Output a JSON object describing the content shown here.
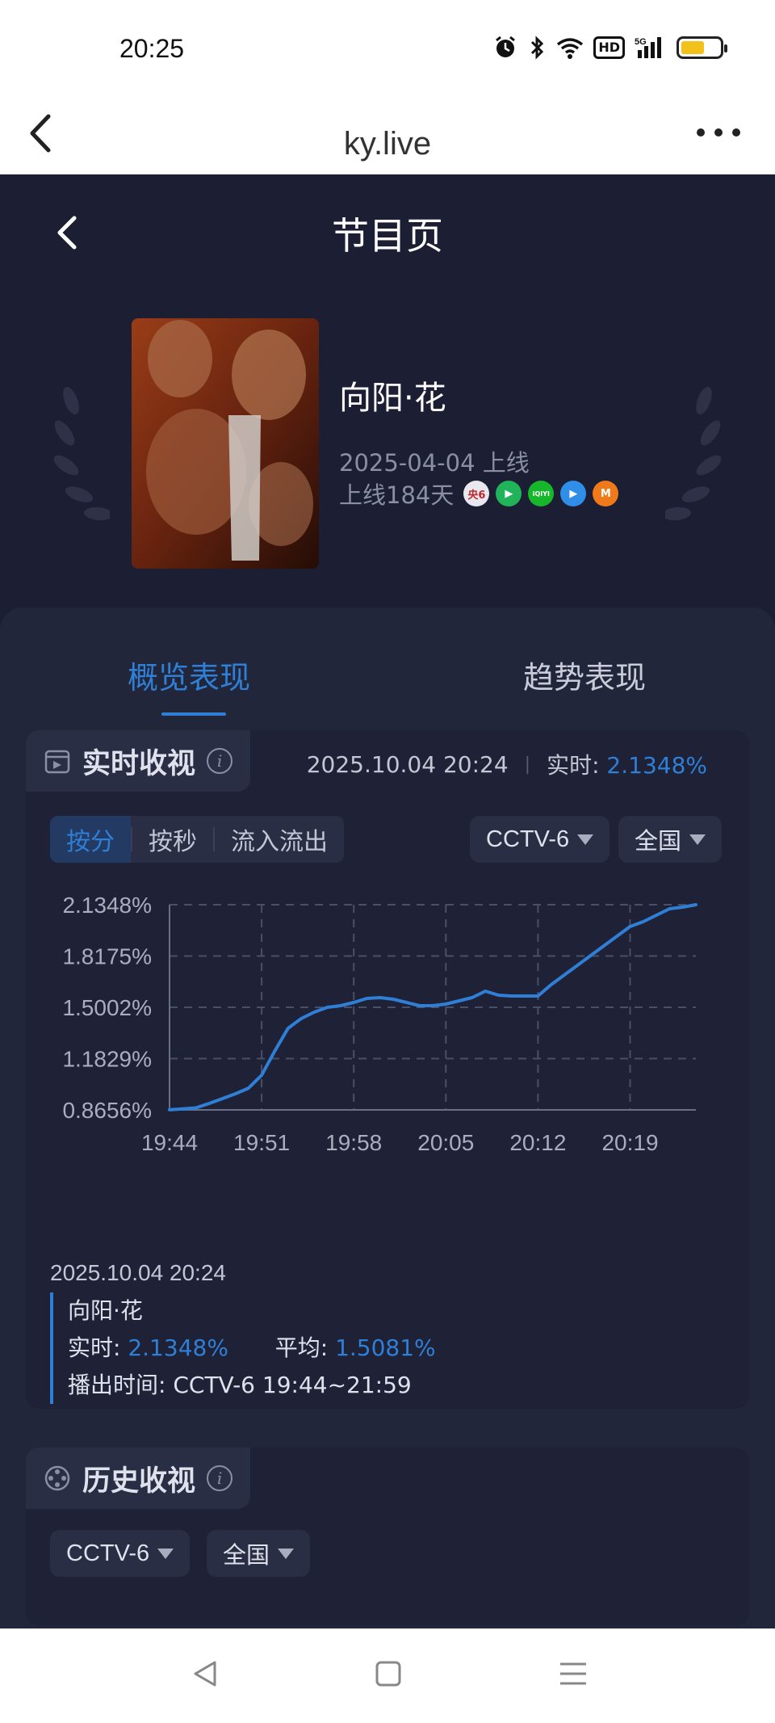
{
  "status": {
    "time": "20:25",
    "hd": "HD",
    "signal": "5G",
    "battery_level": 0.6
  },
  "browser": {
    "title": "ky.live"
  },
  "nav": {
    "title": "节目页"
  },
  "show": {
    "title": "向阳·花",
    "release": "2025-04-04 上线",
    "days": "上线184天",
    "platforms": [
      {
        "name": "cctv6-icon",
        "label": "央6",
        "color": "#e8e8ee"
      },
      {
        "name": "tencent-video-icon",
        "label": "▶",
        "color": "#20b35a"
      },
      {
        "name": "iqiyi-icon",
        "label": "iQIYI",
        "color": "#16b72a"
      },
      {
        "name": "youku-icon",
        "label": "▶",
        "color": "#2e8ee8"
      },
      {
        "name": "mgtv-icon",
        "label": "M",
        "color": "#f07a1a"
      }
    ]
  },
  "tabs": {
    "overview": "概览表现",
    "trend": "趋势表现"
  },
  "realtime": {
    "title": "实时收视",
    "datetime": "2025.10.04 20:24",
    "label": "实时:",
    "value": "2.1348%",
    "modes": [
      "按分",
      "按秒",
      "流入流出"
    ],
    "channel": "CCTV-6",
    "region": "全国"
  },
  "chart_data": {
    "type": "line",
    "x_ticks": [
      "19:44",
      "19:51",
      "19:58",
      "20:05",
      "20:12",
      "20:19"
    ],
    "y_ticks": [
      "2.1348%",
      "1.8175%",
      "1.5002%",
      "1.1829%",
      "0.8656%"
    ],
    "ylim": [
      0.8656,
      2.1348
    ],
    "x_unit": "minutes",
    "xlim": [
      "19:44",
      "20:24"
    ],
    "series": [
      {
        "color": "#2f7fd6",
        "x": [
          "19:44",
          "19:45",
          "19:46",
          "19:47",
          "19:48",
          "19:49",
          "19:50",
          "19:51",
          "19:52",
          "19:53",
          "19:54",
          "19:55",
          "19:56",
          "19:57",
          "19:58",
          "19:59",
          "20:00",
          "20:01",
          "20:02",
          "20:03",
          "20:04",
          "20:05",
          "20:06",
          "20:07",
          "20:08",
          "20:09",
          "20:10",
          "20:11",
          "20:12",
          "20:13",
          "20:14",
          "20:15",
          "20:16",
          "20:17",
          "20:18",
          "20:19",
          "20:20",
          "20:21",
          "20:22",
          "20:23",
          "20:24"
        ],
        "values": [
          0.866,
          0.872,
          0.878,
          0.905,
          0.935,
          0.965,
          1.0,
          1.08,
          1.23,
          1.37,
          1.43,
          1.47,
          1.5,
          1.51,
          1.53,
          1.555,
          1.56,
          1.55,
          1.53,
          1.51,
          1.51,
          1.52,
          1.54,
          1.56,
          1.6,
          1.575,
          1.57,
          1.57,
          1.57,
          1.64,
          1.7,
          1.76,
          1.82,
          1.88,
          1.94,
          2.0,
          2.03,
          2.07,
          2.11,
          2.12,
          2.135
        ]
      }
    ]
  },
  "tooltip": {
    "datetime": "2025.10.04 20:24",
    "show": "向阳·花",
    "rt_label": "实时:",
    "rt_value": "2.1348%",
    "avg_label": "平均:",
    "avg_value": "1.5081%",
    "air_label": "播出时间:",
    "air_value": "CCTV-6 19:44~21:59"
  },
  "history": {
    "title": "历史收视",
    "channel": "CCTV-6",
    "region": "全国"
  }
}
